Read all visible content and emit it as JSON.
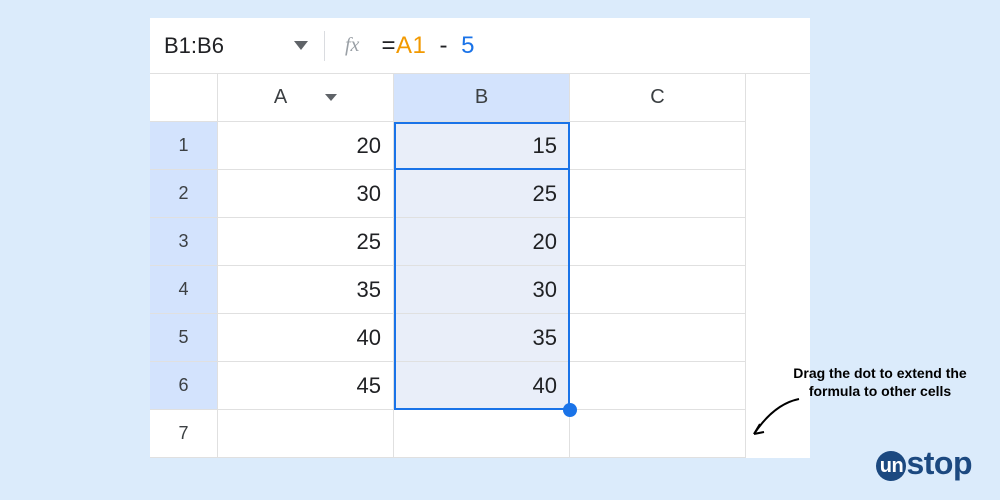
{
  "toolbar": {
    "name_box": "B1:B6",
    "fx_label": "fx",
    "formula_eq": "=",
    "formula_ref": "A1",
    "formula_op": "-",
    "formula_num": "5"
  },
  "columns": [
    "A",
    "B",
    "C"
  ],
  "rows": [
    "1",
    "2",
    "3",
    "4",
    "5",
    "6",
    "7"
  ],
  "cells": {
    "A1": "20",
    "B1": "15",
    "A2": "30",
    "B2": "25",
    "A3": "25",
    "B3": "20",
    "A4": "35",
    "B4": "30",
    "A5": "40",
    "B5": "35",
    "A6": "45",
    "B6": "40"
  },
  "annotation": "Drag the dot to extend the formula to other cells",
  "logo": {
    "prefix": "un",
    "suffix": "stop"
  }
}
